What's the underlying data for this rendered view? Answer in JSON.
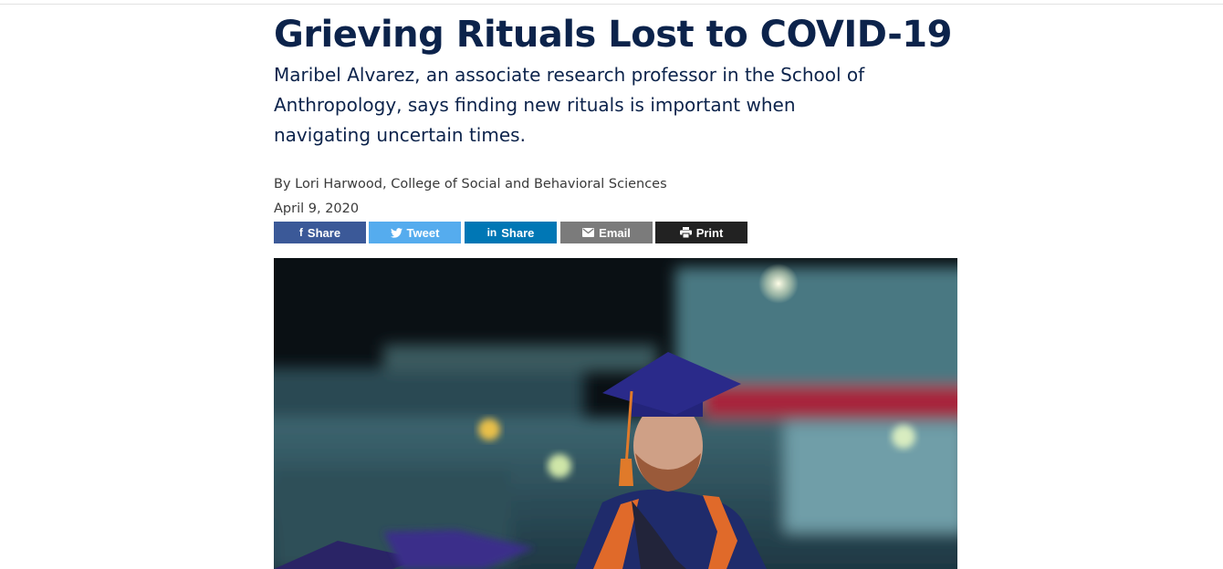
{
  "article": {
    "title": "Grieving Rituals Lost to COVID-19",
    "subtitle": "Maribel Alvarez, an associate research professor in the School of Anthropology, says finding new rituals is important when navigating uncertain times.",
    "byline": "By Lori Harwood, College of Social and Behavioral Sciences",
    "date": "April 9, 2020"
  },
  "share": {
    "facebook": {
      "label": "Share",
      "icon": "facebook-icon",
      "color": "#3b5998"
    },
    "twitter": {
      "label": "Tweet",
      "icon": "twitter-icon",
      "color": "#55acee"
    },
    "linkedin": {
      "label": "Share",
      "icon": "linkedin-icon",
      "color": "#0077b5"
    },
    "email": {
      "label": "Email",
      "icon": "email-icon",
      "color": "#7b7b7b"
    },
    "print": {
      "label": "Print",
      "icon": "printer-icon",
      "color": "#222222"
    }
  },
  "colors": {
    "title": "#0c234b",
    "body_text": "#3a3a3a"
  }
}
